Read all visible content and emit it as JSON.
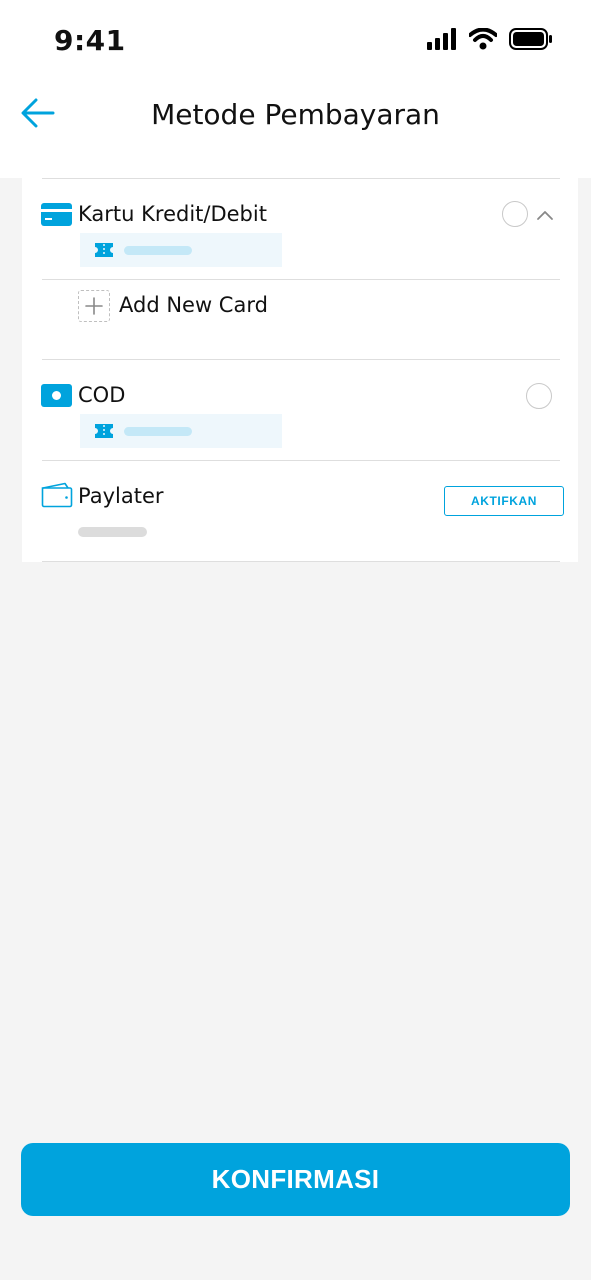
{
  "status_bar": {
    "time": "9:41"
  },
  "header": {
    "title": "Metode Pembayaran"
  },
  "payment_methods": [
    {
      "label": "Kartu Kredit/Debit",
      "icon": "credit-card-icon",
      "expanded": true
    },
    {
      "label": "COD",
      "icon": "cash-icon"
    },
    {
      "label": "Paylater",
      "icon": "wallet-icon",
      "action_label": "AKTIFKAN"
    }
  ],
  "add_card": {
    "label": "Add New Card"
  },
  "confirm_button": {
    "label": "KONFIRMASI"
  },
  "colors": {
    "accent": "#00a3dd",
    "background": "#f4f4f4",
    "divider": "#dedede",
    "placeholder": "#c4e8f7"
  }
}
